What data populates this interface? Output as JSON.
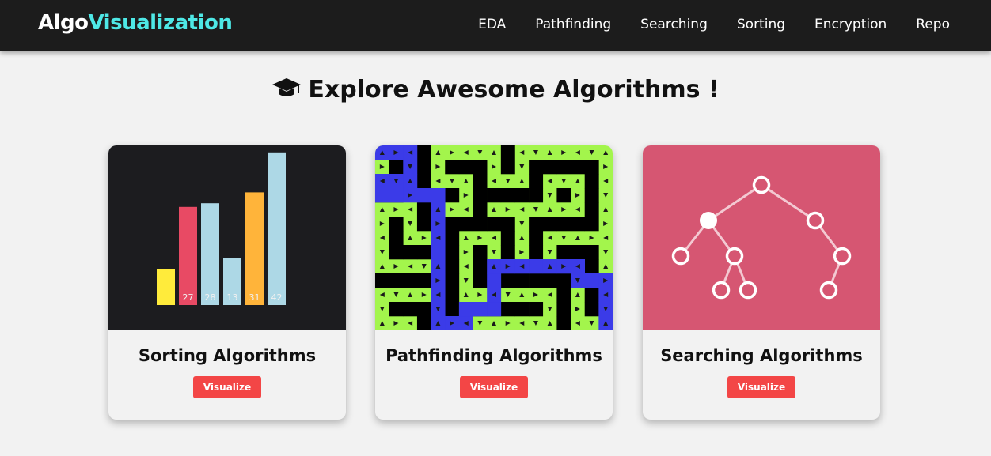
{
  "brand": {
    "part1": "Algo",
    "part2": "Visualization"
  },
  "nav": [
    "EDA",
    "Pathfinding",
    "Searching",
    "Sorting",
    "Encryption",
    "Repo"
  ],
  "heading": "Explore Awesome Algorithms !",
  "cards": [
    {
      "title": "Sorting Algorithms",
      "button": "Visualize"
    },
    {
      "title": "Pathfinding Algorithms",
      "button": "Visualize"
    },
    {
      "title": "Searching Algorithms",
      "button": "Visualize"
    }
  ],
  "sorting_bars": [
    {
      "value": "",
      "height": 10,
      "color": "#ffeb3b"
    },
    {
      "value": "27",
      "height": 27,
      "color": "#e84a64"
    },
    {
      "value": "28",
      "height": 28,
      "color": "#add8e6"
    },
    {
      "value": "13",
      "height": 13,
      "color": "#add8e6"
    },
    {
      "value": "31",
      "height": 31,
      "color": "#ffb43a"
    },
    {
      "value": "42",
      "height": 42,
      "color": "#add8e6"
    }
  ],
  "colors": {
    "nav_bg": "#1c1c1c",
    "accent": "#4ee8e6",
    "button": "#f34646",
    "search_bg": "#d65672"
  }
}
